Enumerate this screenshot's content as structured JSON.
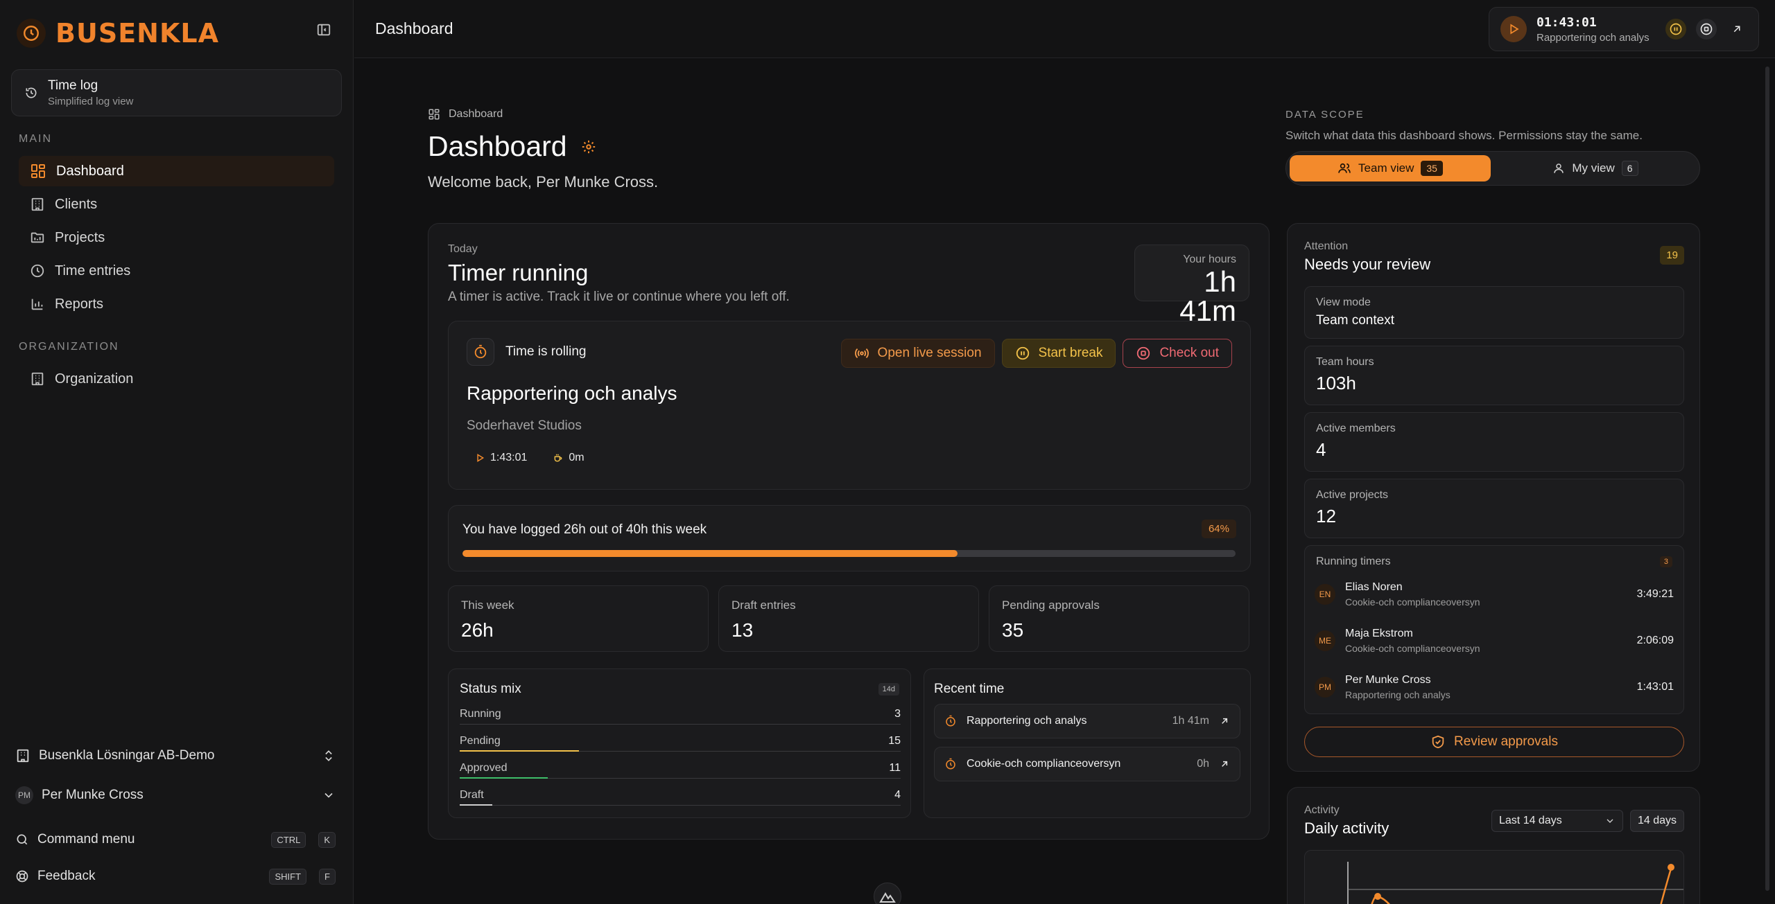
{
  "app": {
    "brand": "BUSENKLA",
    "accent": "#f38a2c"
  },
  "sidebar": {
    "timelog": {
      "title": "Time log",
      "subtitle": "Simplified log view"
    },
    "main_section": "MAIN",
    "items": [
      {
        "label": "Dashboard",
        "icon": "dashboard-icon",
        "active": true
      },
      {
        "label": "Clients",
        "icon": "building-icon"
      },
      {
        "label": "Projects",
        "icon": "folder-icon"
      },
      {
        "label": "Time entries",
        "icon": "clock-icon"
      },
      {
        "label": "Reports",
        "icon": "bar-chart-icon"
      }
    ],
    "org_section": "ORGANIZATION",
    "org_items": [
      {
        "label": "Organization",
        "icon": "building-icon"
      }
    ],
    "workspace": "Busenkla Lösningar AB-Demo",
    "user": {
      "initials": "PM",
      "name": "Per Munke Cross"
    },
    "command_menu": {
      "label": "Command menu",
      "keys": [
        "CTRL",
        "K"
      ]
    },
    "feedback": {
      "label": "Feedback",
      "keys": [
        "SHIFT",
        "F"
      ]
    }
  },
  "header": {
    "title": "Dashboard",
    "timer": {
      "time": "01:43:01",
      "task": "Rapportering och analys"
    }
  },
  "page": {
    "breadcrumb": "Dashboard",
    "title": "Dashboard",
    "welcome": "Welcome back, Per Munke Cross."
  },
  "scope": {
    "label": "DATA SCOPE",
    "description": "Switch what data this dashboard shows. Permissions stay the same.",
    "options": [
      {
        "label": "Team view",
        "count": "35",
        "active": true
      },
      {
        "label": "My view",
        "count": "6",
        "active": false
      }
    ]
  },
  "today": {
    "eyebrow": "Today",
    "title": "Timer running",
    "description": "A timer is active. Track it live or continue where you left off.",
    "your_hours_label": "Your hours",
    "your_hours_value": "1h 41m"
  },
  "rolling": {
    "label": "Time is rolling",
    "actions": {
      "live": "Open live session",
      "break": "Start break",
      "checkout": "Check out"
    },
    "project": "Rapportering och analys",
    "client": "Soderhavet Studios",
    "elapsed": "1:43:01",
    "break_time": "0m"
  },
  "weekly": {
    "label": "You have logged 26h out of 40h this week",
    "percent_label": "64%",
    "progress": 0.64
  },
  "stats": [
    {
      "label": "This week",
      "value": "26h"
    },
    {
      "label": "Draft entries",
      "value": "13"
    },
    {
      "label": "Pending approvals",
      "value": "35"
    }
  ],
  "status_mix": {
    "title": "Status mix",
    "range": "14d",
    "rows": [
      {
        "name": "Running",
        "value": "3",
        "fraction": 0.0,
        "color": "#f38a2c"
      },
      {
        "name": "Pending",
        "value": "15",
        "fraction": 0.27,
        "color": "#f3c24a"
      },
      {
        "name": "Approved",
        "value": "11",
        "fraction": 0.2,
        "color": "#3fbf6a"
      },
      {
        "name": "Draft",
        "value": "4",
        "fraction": 0.074,
        "color": "#cfcfcf"
      }
    ]
  },
  "recent": {
    "title": "Recent time",
    "rows": [
      {
        "name": "Rapportering och analys",
        "duration": "1h 41m"
      },
      {
        "name": "Cookie-och complianceoversyn",
        "duration": "0h"
      }
    ]
  },
  "attention": {
    "eyebrow": "Attention",
    "title": "Needs your review",
    "count": "19",
    "view_mode": {
      "label": "View mode",
      "value": "Team context"
    },
    "team_hours": {
      "label": "Team hours",
      "value": "103h"
    },
    "active_members": {
      "label": "Active members",
      "value": "4"
    },
    "active_projects": {
      "label": "Active projects",
      "value": "12"
    },
    "running_timers": {
      "label": "Running timers",
      "count": "3",
      "rows": [
        {
          "initials": "EN",
          "name": "Elias Noren",
          "project": "Cookie-och complianceoversyn",
          "time": "3:49:21"
        },
        {
          "initials": "ME",
          "name": "Maja Ekstrom",
          "project": "Cookie-och complianceoversyn",
          "time": "2:06:09"
        },
        {
          "initials": "PM",
          "name": "Per Munke Cross",
          "project": "Rapportering och analys",
          "time": "1:43:01"
        }
      ]
    },
    "review_button": "Review approvals"
  },
  "activity": {
    "eyebrow": "Activity",
    "title": "Daily activity",
    "select": "Last 14 days",
    "days_badge": "14 days"
  }
}
